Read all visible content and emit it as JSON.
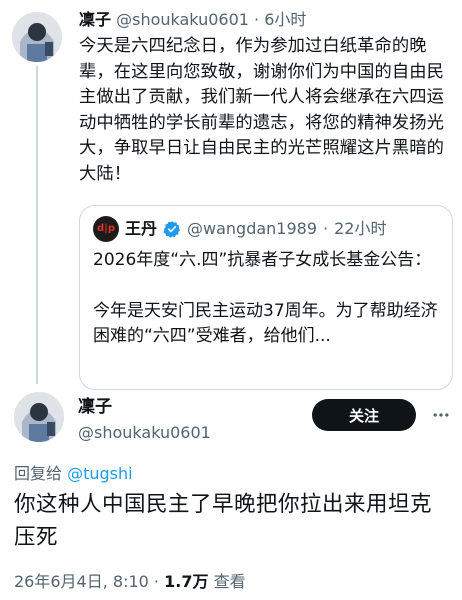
{
  "top_tweet": {
    "name": "凜子",
    "handle": "@shoukaku0601",
    "separator": "·",
    "time": "6小时",
    "text": "今天是六四纪念日，作为参加过白纸革命的晚辈，在这里向您致敬，谢谢你们为中国的自由民主做出了贡献，我们新一代人将会继承在六四运动中牺牲的学长前辈的遗志，将您的精神发扬光大，争取早日让自由民主的光芒照耀这片黑暗的大陆！"
  },
  "quoted_tweet": {
    "avatar_text": "d|p",
    "name": "王丹",
    "verified_icon": "verified-badge-icon",
    "handle": "@wangdan1989",
    "separator": "·",
    "time": "22小时",
    "paragraph_1": "2026年度“六.四”抗暴者子女成长基金公告：",
    "paragraph_2": "今年是天安门民主运动37周年。为了帮助经济困难的“六四”受难者，给他们..."
  },
  "reply_tweet": {
    "name": "凜子",
    "handle": "@shoukaku0601",
    "follow_label": "关注",
    "more_icon": "more-horizontal-icon",
    "reply_prefix": "回复给 ",
    "reply_target": "@tugshi",
    "text": "你这种人中国民主了早晚把你拉出来用坦克压死",
    "date": "26年6月4日, 8:10",
    "separator": "·",
    "views_count": "1.7万",
    "views_label": "查看"
  },
  "colors": {
    "text": "#0f1419",
    "muted": "#536471",
    "link": "#1d9bf0",
    "border": "#cfd9de",
    "verified": "#1d9bf0",
    "follow_bg": "#0f1419"
  }
}
